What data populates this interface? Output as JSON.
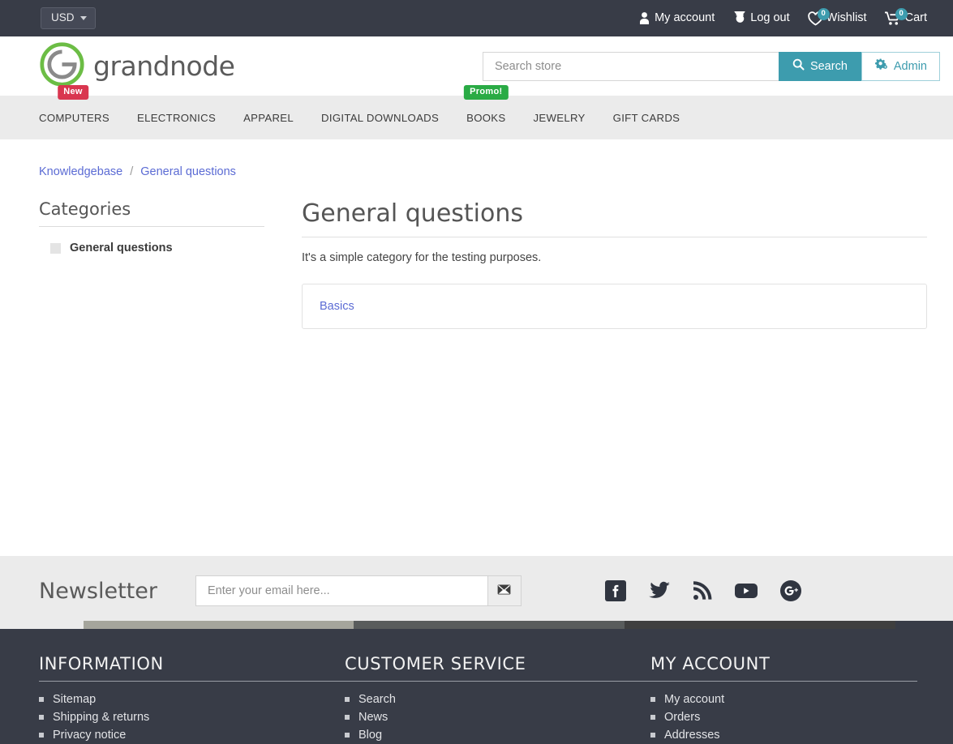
{
  "topbar": {
    "currency": "USD",
    "links": [
      {
        "label": "My account",
        "icon": "user-icon",
        "badge": null
      },
      {
        "label": "Log out",
        "icon": "power-icon",
        "badge": null
      },
      {
        "label": "Wishlist",
        "icon": "heart-icon",
        "badge": "0"
      },
      {
        "label": "Cart",
        "icon": "cart-icon",
        "badge": "0"
      }
    ]
  },
  "header": {
    "logo_text": "grandnode",
    "logo_icon": "grandnode-g-logo",
    "search": {
      "placeholder": "Search store",
      "value": "",
      "button_label": "Search",
      "button_icon": "search-icon"
    },
    "admin": {
      "label": "Admin",
      "icon": "cogs-icon"
    }
  },
  "nav": {
    "items": [
      {
        "label": "COMPUTERS",
        "badge": "New",
        "badge_color": "#d9364f"
      },
      {
        "label": "ELECTRONICS",
        "badge": null
      },
      {
        "label": "APPAREL",
        "badge": null
      },
      {
        "label": "DIGITAL DOWNLOADS",
        "badge": null
      },
      {
        "label": "BOOKS",
        "badge": "Promo!",
        "badge_color": "#2aab45"
      },
      {
        "label": "JEWELRY",
        "badge": null
      },
      {
        "label": "GIFT CARDS",
        "badge": null
      }
    ]
  },
  "breadcrumb": {
    "root": "Knowledgebase",
    "separator": "/",
    "current": "General questions"
  },
  "sidebar": {
    "title": "Categories",
    "items": [
      {
        "label": "General questions"
      }
    ]
  },
  "main": {
    "title": "General questions",
    "description": "It's a simple category for the testing purposes.",
    "articles": [
      {
        "title": "Basics"
      }
    ]
  },
  "newsletter": {
    "title": "Newsletter",
    "placeholder": "Enter your email here...",
    "value": "",
    "button_icon": "envelope-icon"
  },
  "social": [
    {
      "name": "facebook-icon"
    },
    {
      "name": "twitter-icon"
    },
    {
      "name": "rss-icon"
    },
    {
      "name": "youtube-icon"
    },
    {
      "name": "google-plus-icon"
    }
  ],
  "footer": {
    "columns": [
      {
        "heading": "INFORMATION",
        "links": [
          "Sitemap",
          "Shipping & returns",
          "Privacy notice"
        ]
      },
      {
        "heading": "CUSTOMER SERVICE",
        "links": [
          "Search",
          "News",
          "Blog"
        ]
      },
      {
        "heading": "MY ACCOUNT",
        "links": [
          "My account",
          "Orders",
          "Addresses"
        ]
      }
    ]
  },
  "colors": {
    "accent": "#3d9cae",
    "topbar_bg": "#383c47",
    "nav_bg": "#ebebeb",
    "link": "#5b6bd4",
    "logo_green": "#6cbd45"
  }
}
